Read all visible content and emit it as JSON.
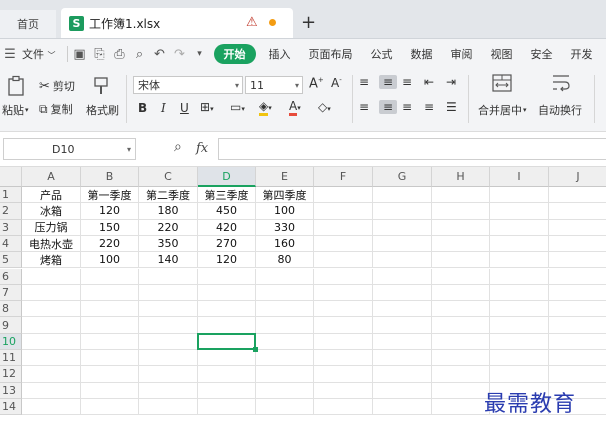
{
  "tabs": {
    "home": "首页",
    "document": "工作簿1.xlsx",
    "doc_logo": "S",
    "add": "+",
    "warning_icon": "⚠"
  },
  "menu": {
    "file": "文件",
    "kaishi": "开始",
    "items": [
      "插入",
      "页面布局",
      "公式",
      "数据",
      "审阅",
      "视图",
      "安全",
      "开发"
    ]
  },
  "ribbon": {
    "paste": "粘贴",
    "cut": "剪切",
    "copy": "复制",
    "format_painter": "格式刷",
    "font_name": "宋体",
    "font_size": "11",
    "bold": "B",
    "italic": "I",
    "underline": "U",
    "font_color_letter": "A",
    "merge_center": "合并居中",
    "wrap_text": "自动换行"
  },
  "formula_bar": {
    "name_box": "D10",
    "fx": "fx",
    "value": ""
  },
  "sheet": {
    "columns": [
      "A",
      "B",
      "C",
      "D",
      "E",
      "F",
      "G",
      "H",
      "I",
      "J"
    ],
    "rows": [
      "1",
      "2",
      "3",
      "4",
      "5",
      "6",
      "7",
      "8",
      "9",
      "10",
      "11",
      "12",
      "13",
      "14"
    ],
    "active_cell": "D10",
    "data": [
      [
        "产品",
        "第一季度",
        "第二季度",
        "第三季度",
        "第四季度"
      ],
      [
        "冰箱",
        "120",
        "180",
        "450",
        "100"
      ],
      [
        "压力锅",
        "150",
        "220",
        "420",
        "330"
      ],
      [
        "电热水壶",
        "220",
        "350",
        "270",
        "160"
      ],
      [
        "烤箱",
        "100",
        "140",
        "120",
        "80"
      ]
    ]
  },
  "watermark": "最需教育",
  "colors": {
    "accent": "#1aa260",
    "watermark": "#2a3cb0"
  }
}
